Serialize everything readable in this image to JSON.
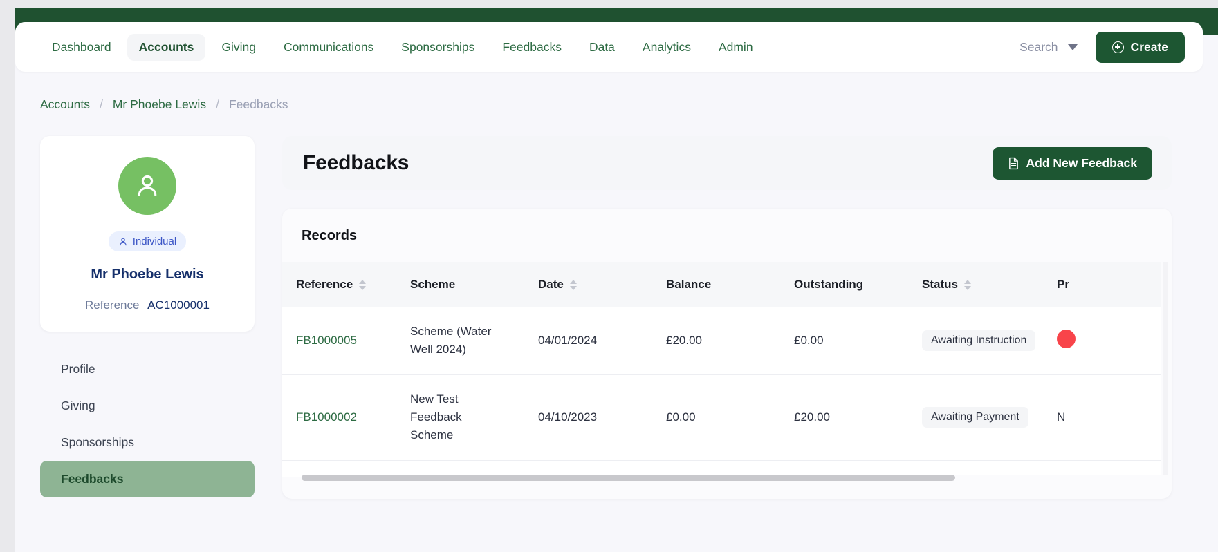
{
  "theme": {
    "brand_green": "#1d5632",
    "band_green": "#1f5130",
    "accent_green": "#2d6b43",
    "sidebar_active_bg": "#8eb494",
    "avatar_green": "#76c063",
    "badge_blue_bg": "#eaf0fe",
    "badge_blue_text": "#3b55c6",
    "navy": "#16306b",
    "status_red": "#f8444a"
  },
  "topnav": {
    "items": [
      {
        "label": "Dashboard",
        "active": false
      },
      {
        "label": "Accounts",
        "active": true
      },
      {
        "label": "Giving",
        "active": false
      },
      {
        "label": "Communications",
        "active": false
      },
      {
        "label": "Sponsorships",
        "active": false
      },
      {
        "label": "Feedbacks",
        "active": false
      },
      {
        "label": "Data",
        "active": false
      },
      {
        "label": "Analytics",
        "active": false
      },
      {
        "label": "Admin",
        "active": false
      }
    ],
    "search_label": "Search",
    "search_icon": "chevron-down-icon",
    "create_label": "Create",
    "create_icon": "plus-circle-icon"
  },
  "breadcrumb": {
    "items": [
      {
        "label": "Accounts",
        "current": false
      },
      {
        "label": "Mr Phoebe Lewis",
        "current": false
      },
      {
        "label": "Feedbacks",
        "current": true
      }
    ],
    "separator": "/"
  },
  "profile": {
    "avatar_icon": "person-icon",
    "type_badge": {
      "icon": "person-icon",
      "label": "Individual"
    },
    "name": "Mr Phoebe Lewis",
    "reference_label": "Reference",
    "reference_value": "AC1000001"
  },
  "sidebar": {
    "items": [
      {
        "label": "Profile",
        "active": false
      },
      {
        "label": "Giving",
        "active": false
      },
      {
        "label": "Sponsorships",
        "active": false
      },
      {
        "label": "Feedbacks",
        "active": true
      }
    ]
  },
  "main": {
    "title": "Feedbacks",
    "add_button": {
      "label": "Add New Feedback",
      "icon": "document-icon"
    },
    "records_title": "Records",
    "table": {
      "columns": [
        {
          "label": "Reference",
          "sortable": true
        },
        {
          "label": "Scheme",
          "sortable": false
        },
        {
          "label": "Date",
          "sortable": true
        },
        {
          "label": "Balance",
          "sortable": false
        },
        {
          "label": "Outstanding",
          "sortable": false
        },
        {
          "label": "Status",
          "sortable": true
        },
        {
          "label": "Pr",
          "sortable": false
        }
      ],
      "rows": [
        {
          "reference": "FB1000005",
          "scheme": "Scheme (Water Well 2024)",
          "date": "04/01/2024",
          "balance": "£20.00",
          "outstanding": "£0.00",
          "status": "Awaiting Instruction",
          "pr": ""
        },
        {
          "reference": "FB1000002",
          "scheme": "New Test Feedback Scheme",
          "date": "04/10/2023",
          "balance": "£0.00",
          "outstanding": "£20.00",
          "status": "Awaiting Payment",
          "pr": "N"
        }
      ]
    }
  }
}
